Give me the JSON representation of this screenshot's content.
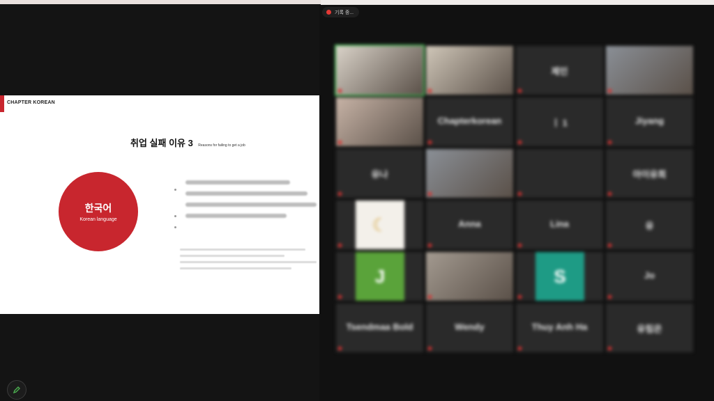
{
  "recording": {
    "label": "기록 중..."
  },
  "slide": {
    "brand": "CHAPTER KOREAN",
    "title_kor": "취업 실패 이유 3",
    "title_eng": "Reasons for failing to get a job",
    "circle_kor": "한국어",
    "circle_eng": "Korean language"
  },
  "participants": [
    {
      "id": "p1",
      "type": "video",
      "name": "",
      "active": true
    },
    {
      "id": "p2",
      "type": "video",
      "name": ""
    },
    {
      "id": "p3",
      "type": "name",
      "name": "제인"
    },
    {
      "id": "p4",
      "type": "video",
      "name": ""
    },
    {
      "id": "p5",
      "type": "video",
      "name": ""
    },
    {
      "id": "p6",
      "type": "name",
      "name": "Chapterkorean"
    },
    {
      "id": "p7",
      "type": "name",
      "name": "ㅣ 1"
    },
    {
      "id": "p8",
      "type": "name",
      "name": "Jiyang"
    },
    {
      "id": "p9",
      "type": "name",
      "name": "유나"
    },
    {
      "id": "p10",
      "type": "video",
      "name": ""
    },
    {
      "id": "p11",
      "type": "name",
      "name": ""
    },
    {
      "id": "p12",
      "type": "name",
      "name": "아이유희"
    },
    {
      "id": "p13",
      "type": "avatar-moon",
      "name": ""
    },
    {
      "id": "p14",
      "type": "name",
      "name": "Anna"
    },
    {
      "id": "p15",
      "type": "name",
      "name": "Lina"
    },
    {
      "id": "p16",
      "type": "name",
      "name": "유"
    },
    {
      "id": "p17",
      "type": "avatar",
      "letter": "J",
      "color": "#5aa33a",
      "name": ""
    },
    {
      "id": "p18",
      "type": "video",
      "name": ""
    },
    {
      "id": "p19",
      "type": "avatar",
      "letter": "S",
      "color": "#1e9b85",
      "name": ""
    },
    {
      "id": "p20",
      "type": "name",
      "name": "Jo"
    },
    {
      "id": "p21",
      "type": "name",
      "name": "Tsendmaa Bold"
    },
    {
      "id": "p22",
      "type": "name",
      "name": "Wendy"
    },
    {
      "id": "p23",
      "type": "name",
      "name": "Thuy Anh Ha"
    },
    {
      "id": "p24",
      "type": "name",
      "name": "유림은"
    }
  ],
  "colors": {
    "accent_red": "#c8262e",
    "active_speaker": "#3fb650",
    "mic_muted": "#d9302f"
  },
  "icons": {
    "annotate": "pencil-icon",
    "record": "record-dot-icon"
  }
}
